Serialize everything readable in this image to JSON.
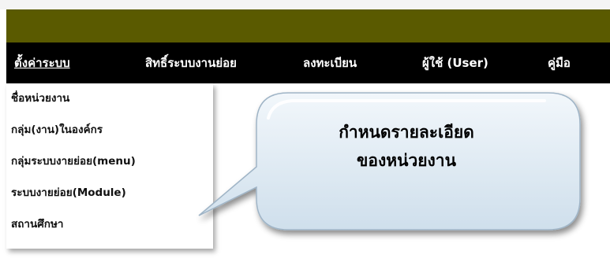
{
  "nav": {
    "items": [
      {
        "label": "ตั้งค่าระบบ",
        "active": true
      },
      {
        "label": "สิทธิ์ระบบงานย่อย",
        "active": false
      },
      {
        "label": "ลงทะเบียน",
        "active": false
      },
      {
        "label": "ผู้ใช้ (User)",
        "active": false
      },
      {
        "label": "คู่มือ",
        "active": false
      }
    ]
  },
  "dropdown": {
    "items": [
      "ชื่อหน่วยงาน",
      "กลุ่ม(งาน)ในองค์กร",
      "กลุ่มระบบงายย่อย(menu)",
      "ระบบงายย่อย(Module)",
      "สถานศึกษา"
    ]
  },
  "callout": {
    "line1": "กำหนดรายละเอียด",
    "line2": "ของหน่วยงาน"
  },
  "colors": {
    "header_bar": "#5a5a00",
    "nav_background": "#000000",
    "nav_text": "#ffffff",
    "callout_fill": "#dfeaf2"
  }
}
